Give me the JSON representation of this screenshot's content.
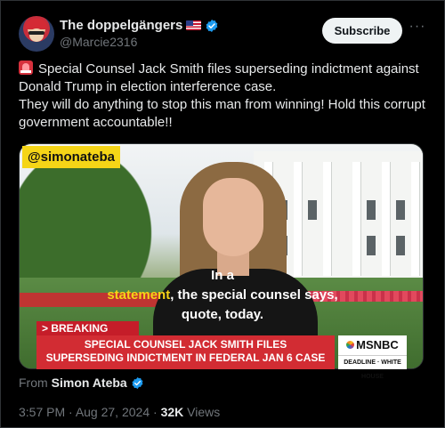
{
  "author": {
    "display_name": "The doppelgängers",
    "handle": "@Marcie2316",
    "flag_icon": "us-flag-icon",
    "verified_icon": "verified-badge-icon",
    "verified_color": "#1d9bf0"
  },
  "header": {
    "subscribe_label": "Subscribe",
    "more_label": "···"
  },
  "tweet": {
    "line1": "Special Counsel Jack Smith files superseding indictment against Donald Trump in election interference case.",
    "line2": "They will do anything to stop this man from winning! Hold this corrupt government accountable!!",
    "leading_icon": "siren-icon"
  },
  "video": {
    "channel_tag": "@simonateba",
    "caption_prefix": "In a ",
    "caption_highlight": "statement",
    "caption_rest": ", the special counsel says,",
    "caption_line2": "quote, today.",
    "breaking_label": "> BREAKING NEWS",
    "headline_line1": "SPECIAL COUNSEL JACK SMITH FILES",
    "headline_line2": "SUPERSEDING INDICTMENT IN FEDERAL JAN 6 CASE",
    "network": "MSNBC",
    "show": "DEADLINE · WHITE HOUSE"
  },
  "source": {
    "from_label": "From",
    "from_name": "Simon Ateba"
  },
  "meta": {
    "time": "3:57 PM",
    "date": "Aug 27, 2024",
    "separator": " · ",
    "views_count": "32K",
    "views_label": "Views"
  },
  "colors": {
    "background": "#000000",
    "text": "#e7e9ea",
    "muted": "#71767b",
    "accent": "#1d9bf0",
    "breaking_red": "#c51d29",
    "tag_yellow": "#f5d517"
  }
}
